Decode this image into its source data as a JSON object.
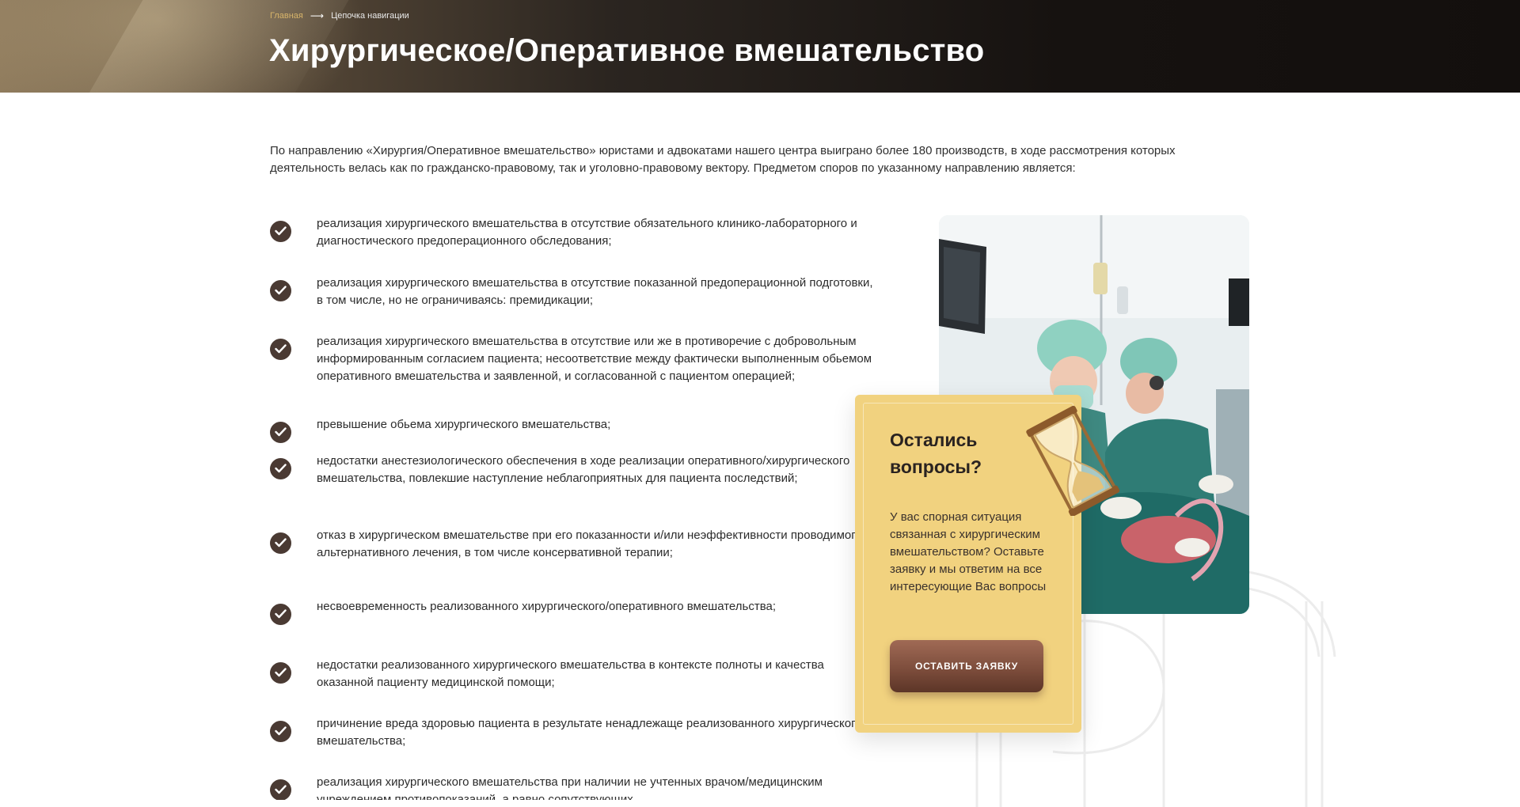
{
  "breadcrumb": {
    "home": "Главная",
    "current": "Цепочка навигации"
  },
  "page": {
    "title": "Хирургическое/Оперативное вмешательство"
  },
  "intro": {
    "text": "По направлению «Хирургия/Оперативное вмешательство» юристами и адвокатами нашего центра выиграно более 180 производств, в ходе рассмотрения которых деятельность велась как по гражданско-правовому, так и уголовно-правовому вектору. Предметом споров по указанному направлению является:"
  },
  "list": {
    "items": [
      "реализация хирургического вмешательства в отсутствие обязательного клинико-лабораторного и диагностического предоперационного обследования;",
      "реализация хирургического вмешательства в отсутствие показанной предоперационной подготовки, в том числе, но не ограничиваясь: премидикации;",
      "реализация хирургического вмешательства в отсутствие или же в противоречие с добровольным информированным согласием пациента; несоответствие между фактически выполненным обьемом оперативного вмешательства и заявленной, и согласованной с пациентом операцией;",
      "превышение обьема хирургического вмешательства;",
      "недостатки анестезиологического обеспечения в ходе реализации оперативного/хирургического  вмешательства, повлекшие наступление неблагоприятных для пациента последствий;",
      "отказ в хирургическом вмешательстве при его показанности и/или неэффективности проводимого альтернативного лечения, в том числе консервативной терапии;",
      "несвоевременность реализованного хирургического/оперативного вмешательства;",
      "недостатки реализованного хирургического вмешательства в контексте полноты и качества оказанной пациенту медицинской помощи;",
      "причинение вреда здоровью пациента в результате ненадлежаще реализованного хирургического вмешательства;",
      "реализация хирургического вмешательства при наличии не учтенных врачом/медицинским учреждением противопоказаний, а равно сопутствующих"
    ]
  },
  "card": {
    "title": "Остались вопросы?",
    "text": "У вас спорная ситуация связанная с хирургическим вмешательством? Оставьте заявку и мы ответим на все интересующие Вас вопросы",
    "button": "ОСТАВИТЬ ЗАЯВКУ"
  },
  "colors": {
    "hero_dark": "#161210",
    "breadcrumb_accent": "#d7b46a",
    "check_bg": "#4a3a33",
    "card_bg": "#f1d27f",
    "button_bg": "#7a4b3a"
  },
  "icons": {
    "breadcrumb_separator": "arrow-right-icon",
    "list_bullet": "check-circle-icon",
    "card_decor": "hourglass-icon"
  }
}
